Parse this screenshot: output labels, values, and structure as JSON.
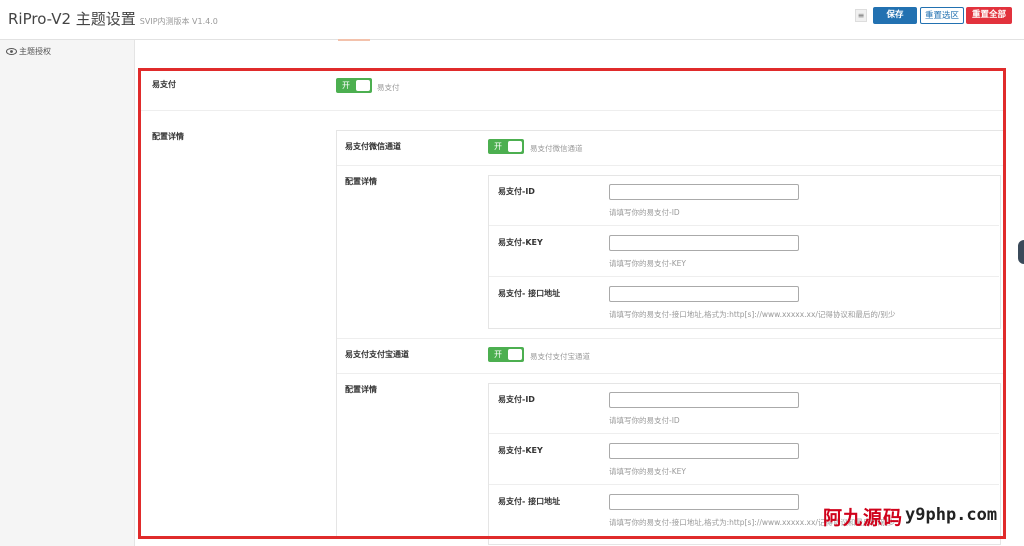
{
  "header": {
    "title": "RiPro-V2 主题设置",
    "version": "SVIP内测版本 V1.4.0",
    "expand_icon": "≡",
    "save_label": "保存",
    "reset_section_label": "重置选区",
    "reset_all_label": "重置全部"
  },
  "sidebar": {
    "items": [
      {
        "icon": "eye-icon",
        "label": "主题授权"
      }
    ]
  },
  "epay": {
    "label": "易支付",
    "switch_text": "开",
    "desc": "易支付",
    "config_label": "配置详情",
    "wechat": {
      "label": "易支付微信通道",
      "switch_text": "开",
      "desc": "易支付微信通道",
      "config_label": "配置详情",
      "id_label": "易支付-ID",
      "id_value": "",
      "id_desc": "请填写你的易支付-ID",
      "key_label": "易支付-KEY",
      "key_value": "",
      "key_desc": "请填写你的易支付-KEY",
      "url_label": "易支付- 接口地址",
      "url_value": "",
      "url_desc": "请填写你的易支付-接口地址,格式为:http[s]://www.xxxxx.xx/记得协议和最后的/别少"
    },
    "alipay": {
      "label": "易支付支付宝通道",
      "switch_text": "开",
      "desc": "易支付支付宝通道",
      "config_label": "配置详情",
      "id_label": "易支付-ID",
      "id_value": "",
      "id_desc": "请填写你的易支付-ID",
      "key_label": "易支付-KEY",
      "key_value": "",
      "key_desc": "请填写你的易支付-KEY",
      "url_label": "易支付- 接口地址",
      "url_value": "",
      "url_desc": "请填写你的易支付-接口地址,格式为:http[s]://www.xxxxx.xx/记得协议和最后的/别少"
    }
  },
  "watermark": {
    "cn": "阿九源码",
    "en": "y9php.com"
  },
  "colors": {
    "accent": "#2271b1",
    "danger": "#e2323d",
    "switch_on": "#4caf50",
    "highlight_border": "#e02b2b"
  }
}
